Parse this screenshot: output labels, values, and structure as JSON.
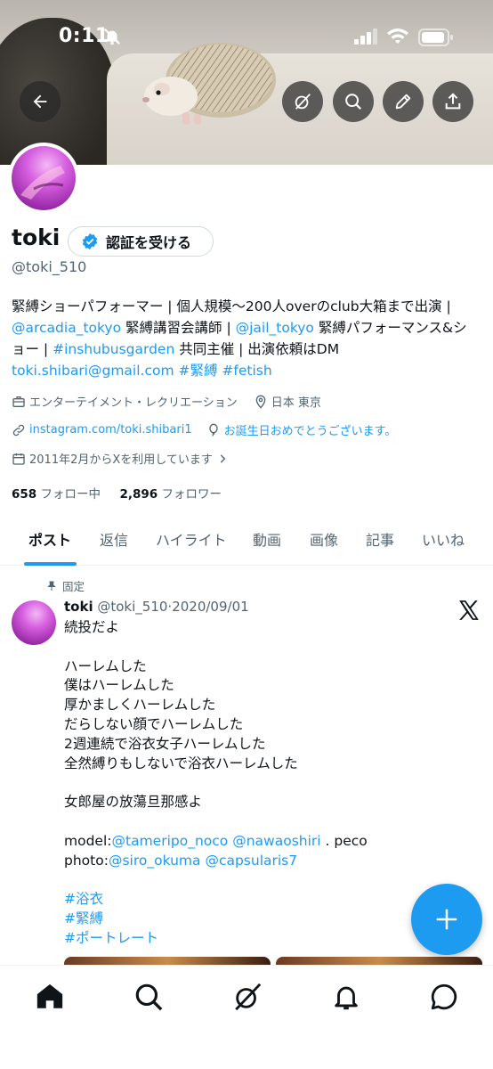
{
  "status_bar": {
    "time": "0:11"
  },
  "profile": {
    "display_name": "toki",
    "verify_button": "認証を受ける",
    "handle": "@toki_510",
    "bio_lines": [
      [
        {
          "t": "緊縛ショーパフォーマー | 個人規模〜200人overのclub大箱まで出演 |",
          "link": false
        }
      ],
      [
        {
          "t": "@arcadia_tokyo",
          "link": true
        },
        {
          "t": " 緊縛講習会講師 | ",
          "link": false
        },
        {
          "t": "@jail_tokyo",
          "link": true
        },
        {
          "t": " 緊縛パフォーマンス&シ",
          "link": false
        }
      ],
      [
        {
          "t": "ョー | ",
          "link": false
        },
        {
          "t": "#inshubusgarden",
          "link": true
        },
        {
          "t": " 共同主催 | 出演依頼はDM",
          "link": false
        }
      ],
      [
        {
          "t": "toki.shibari@gmail.com #緊縛 #fetish",
          "link": true
        }
      ]
    ],
    "category": "エンターテイメント・レクリエーション",
    "location": "日本 東京",
    "website": "instagram.com/toki.shibari1",
    "birthday": "お誕生日おめでとうございます。",
    "joined": "2011年2月からXを利用しています",
    "following_count": "658",
    "following_label": "フォロー中",
    "followers_count": "2,896",
    "followers_label": "フォロワー"
  },
  "tabs": [
    "ポスト",
    "返信",
    "ハイライト",
    "動画",
    "画像",
    "記事",
    "いいね"
  ],
  "post": {
    "pinned_label": "固定",
    "author": "toki",
    "handle": "@toki_510",
    "separator": "·",
    "date": "2020/09/01",
    "lines": [
      [
        {
          "t": "続投だよ",
          "link": false
        }
      ],
      [],
      [
        {
          "t": "ハーレムした",
          "link": false
        }
      ],
      [
        {
          "t": "僕はハーレムした",
          "link": false
        }
      ],
      [
        {
          "t": "厚かましくハーレムした",
          "link": false
        }
      ],
      [
        {
          "t": "だらしない顔でハーレムした",
          "link": false
        }
      ],
      [
        {
          "t": "2週連続で浴衣女子ハーレムした",
          "link": false
        }
      ],
      [
        {
          "t": "全然縛りもしないで浴衣ハーレムした",
          "link": false
        }
      ],
      [],
      [
        {
          "t": "女郎屋の放蕩旦那感よ",
          "link": false
        }
      ],
      [],
      [
        {
          "t": "model:",
          "link": false
        },
        {
          "t": "@tameripo_noco",
          "link": true
        },
        {
          "t": " ",
          "link": false
        },
        {
          "t": "@nawaoshiri",
          "link": true
        },
        {
          "t": " . peco",
          "link": false
        }
      ],
      [
        {
          "t": "photo:",
          "link": false
        },
        {
          "t": "@siro_okuma",
          "link": true
        },
        {
          "t": " ",
          "link": false
        },
        {
          "t": "@capsularis7",
          "link": true
        }
      ],
      [],
      [
        {
          "t": "#浴衣",
          "link": true
        }
      ],
      [
        {
          "t": "#緊縛",
          "link": true
        }
      ],
      [
        {
          "t": "#ポートレート",
          "link": true
        }
      ]
    ]
  },
  "colors": {
    "accent": "#1d9bf0",
    "text": "#0f1419",
    "muted": "#536471"
  },
  "icons": [
    "back-arrow-icon",
    "grok-icon",
    "search-icon",
    "edit-pencil-icon",
    "share-icon",
    "verified-badge-icon",
    "briefcase-icon",
    "location-pin-icon",
    "link-icon",
    "balloon-icon",
    "calendar-icon",
    "chevron-right-icon",
    "pin-icon",
    "x-logo-icon",
    "plus-icon",
    "home-icon",
    "explore-icon",
    "bell-icon",
    "messages-icon"
  ]
}
